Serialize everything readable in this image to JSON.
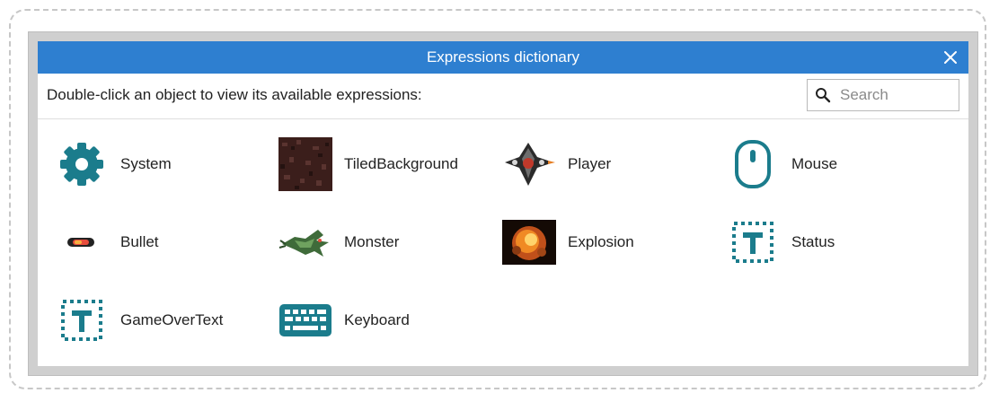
{
  "dialog": {
    "title": "Expressions dictionary",
    "instructions": "Double-click an object to view its available expressions:",
    "search_placeholder": "Search"
  },
  "objects": [
    {
      "label": "System",
      "icon": "gear-icon"
    },
    {
      "label": "TiledBackground",
      "icon": "tiled-background-icon"
    },
    {
      "label": "Player",
      "icon": "player-ship-icon"
    },
    {
      "label": "Mouse",
      "icon": "mouse-icon"
    },
    {
      "label": "Bullet",
      "icon": "bullet-icon"
    },
    {
      "label": "Monster",
      "icon": "monster-icon"
    },
    {
      "label": "Explosion",
      "icon": "explosion-icon"
    },
    {
      "label": "Status",
      "icon": "text-object-icon"
    },
    {
      "label": "GameOverText",
      "icon": "text-object-icon"
    },
    {
      "label": "Keyboard",
      "icon": "keyboard-icon"
    }
  ],
  "colors": {
    "titlebar": "#2e7fd0",
    "accent_teal": "#1b7c8c"
  }
}
